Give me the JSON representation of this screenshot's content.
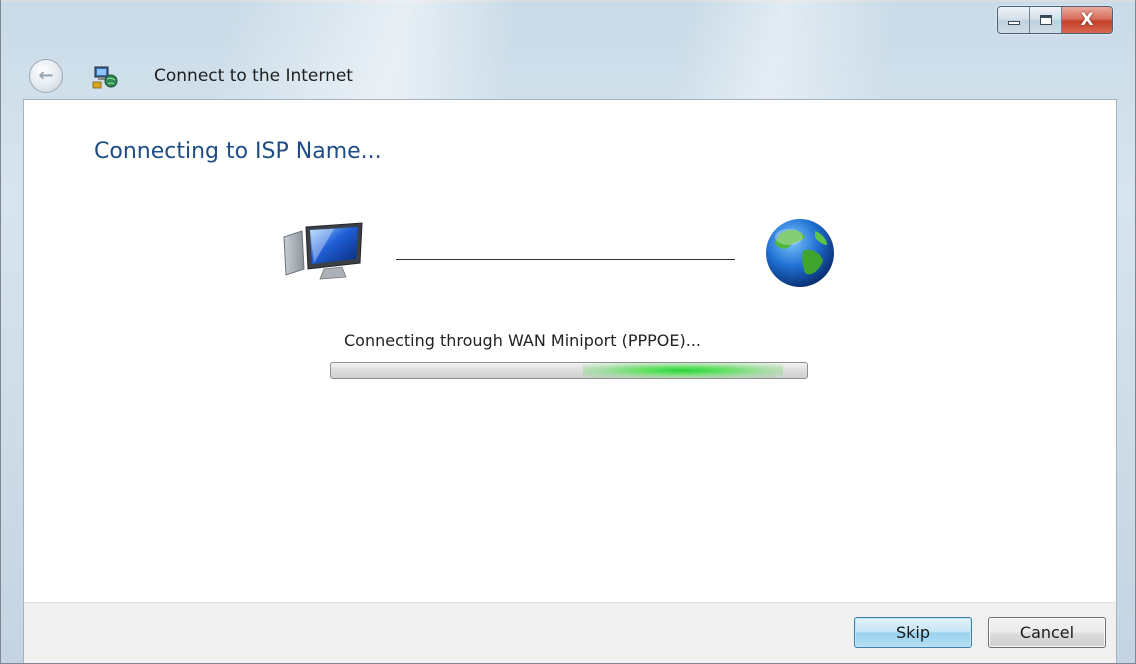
{
  "window": {
    "title": "Connect to the Internet",
    "caption_buttons": {
      "minimize_icon": "minimize-icon",
      "maximize_icon": "maximize-icon",
      "close_glyph": "X"
    }
  },
  "main": {
    "heading": "Connecting to ISP Name...",
    "status_text": "Connecting through WAN Miniport (PPPOE)...",
    "progress": {
      "mode": "indeterminate",
      "highlight_start_fraction": 0.53,
      "highlight_end_fraction": 0.95
    },
    "icons": {
      "computer": "computer-icon",
      "connection_line": "connection-line",
      "internet": "globe-icon"
    }
  },
  "footer": {
    "skip_label": "Skip",
    "cancel_label": "Cancel"
  },
  "colors": {
    "heading": "#1e4d84",
    "progress_glow": "#2bd23a",
    "close_button": "#c3402a"
  }
}
